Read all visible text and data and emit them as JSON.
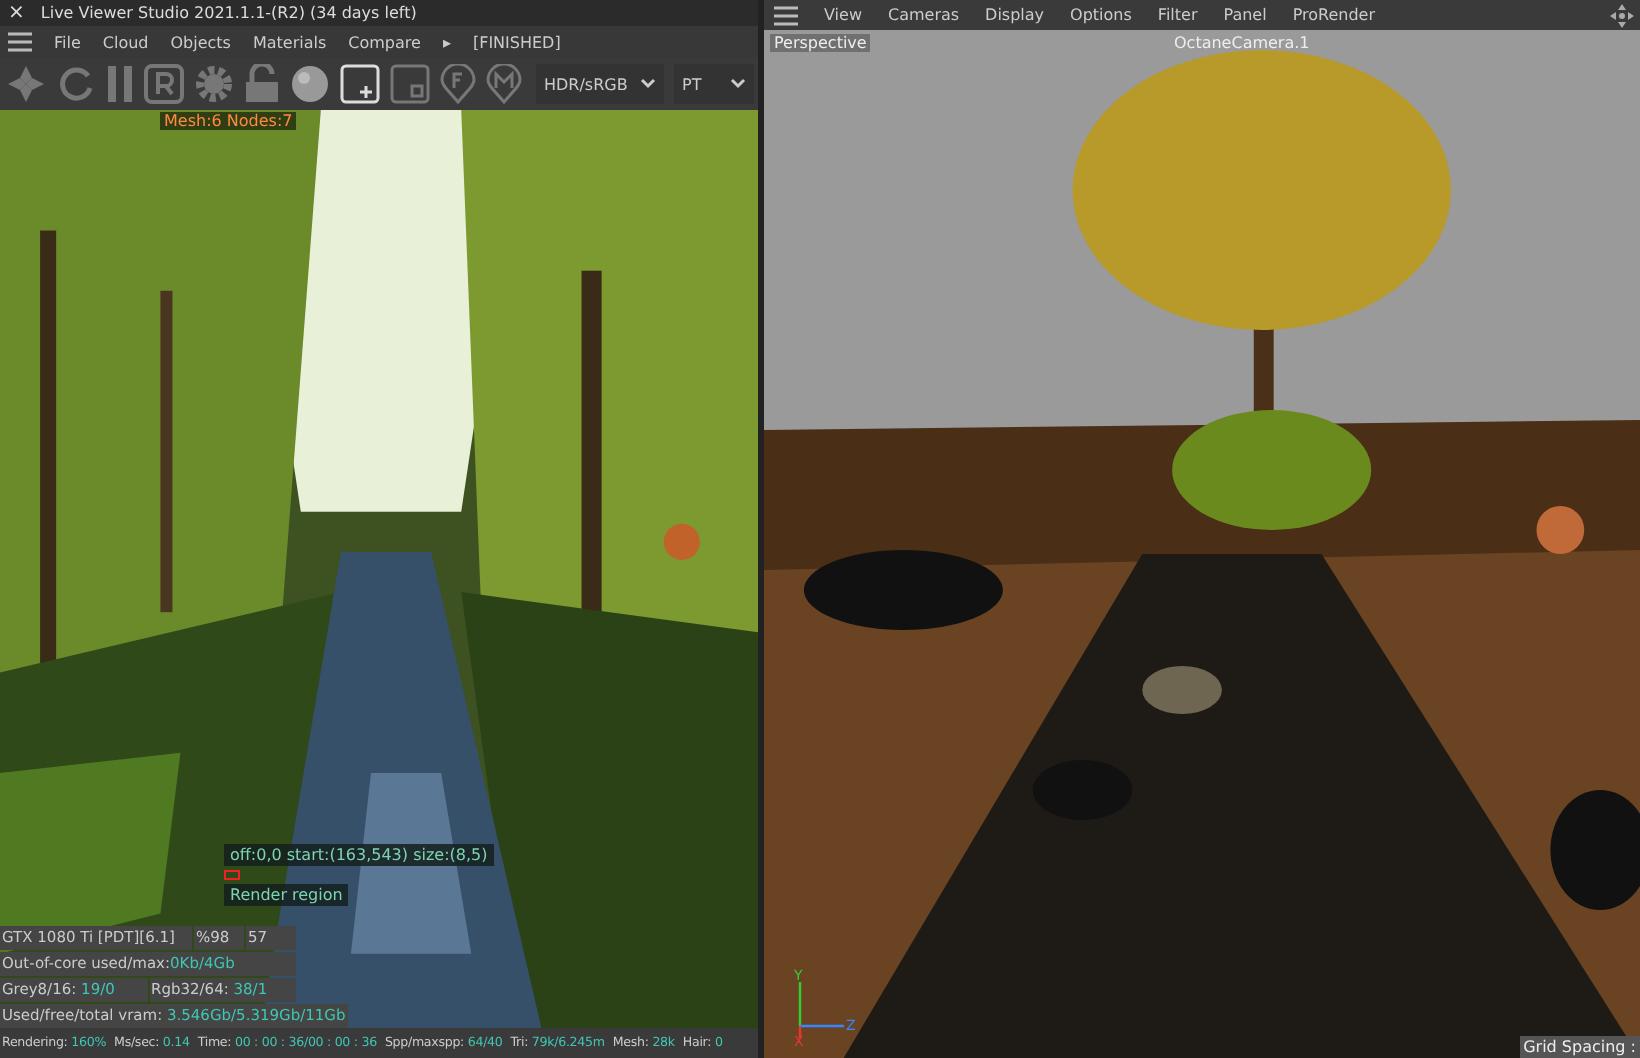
{
  "window": {
    "close": "×",
    "title": "Live Viewer Studio 2021.1.1-(R2) (34 days left)"
  },
  "left_menu": {
    "items": [
      "File",
      "Cloud",
      "Objects",
      "Materials",
      "Compare"
    ],
    "arrow": "▸",
    "status": "[FINISHED]"
  },
  "toolbar": {
    "dropdowns": [
      "HDR/sRGB",
      "PT"
    ]
  },
  "render": {
    "kind": "picture",
    "info": "Mesh:6 Nodes:7",
    "region_info": "off:0,0 start:(163,543) size:(8,5)",
    "region_label": "Render region"
  },
  "stats": [
    {
      "cells": [
        {
          "label": "GTX 1080 Ti [PDT][6.1]"
        },
        {
          "label": "%98"
        },
        {
          "label": "57"
        }
      ]
    },
    {
      "cells": [
        {
          "label": "Out-of-core used/max:",
          "value": "0Kb/4Gb"
        }
      ]
    },
    {
      "cells": [
        {
          "label": "Grey8/16: ",
          "value": "19/0"
        },
        {
          "label": "Rgb32/64: ",
          "value": "38/1"
        }
      ]
    },
    {
      "cells": [
        {
          "label": "Used/free/total vram: ",
          "value": "3.546Gb/5.319Gb/11Gb"
        }
      ]
    }
  ],
  "status_bar": [
    {
      "label": "Rendering: ",
      "value": "160%"
    },
    {
      "label": "Ms/sec: ",
      "value": "0.14"
    },
    {
      "label": "Time: ",
      "value": "00 : 00 : 36/00 : 00 : 36"
    },
    {
      "label": "Spp/maxspp: ",
      "value": "64/40"
    },
    {
      "label": "Tri: ",
      "value": "79k/6.245m"
    },
    {
      "label": "Mesh: ",
      "value": "28k"
    },
    {
      "label": "Hair: ",
      "value": "0"
    }
  ],
  "viewport_menu": [
    "View",
    "Cameras",
    "Display",
    "Options",
    "Filter",
    "Panel",
    "ProRender"
  ],
  "viewport": {
    "kind": "picture",
    "view_name": "Perspective",
    "camera": "OctaneCamera.1",
    "axes": [
      "Y",
      "Z",
      "X"
    ],
    "grid_label": "Grid Spacing :"
  }
}
